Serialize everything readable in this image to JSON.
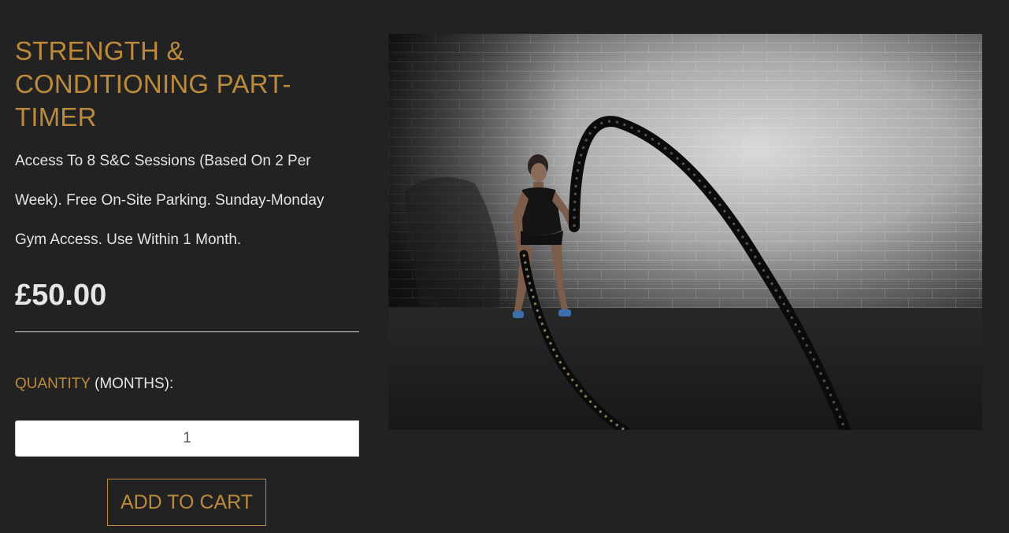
{
  "product": {
    "title": "STRENGTH & CONDITIONING PART-TIMER",
    "description": "Access To 8 S&C Sessions (Based On 2 Per Week). Free On-Site Parking. Sunday-Monday Gym Access. Use Within 1 Month.",
    "price": "£50.00"
  },
  "quantity": {
    "label_accent": "QUANTITY",
    "label_rest": " (MONTHS):",
    "value": "1"
  },
  "cart": {
    "button_label": "ADD TO CART"
  },
  "colors": {
    "background": "#222222",
    "accent": "#bc8a3c",
    "text": "#e4e4e4"
  }
}
